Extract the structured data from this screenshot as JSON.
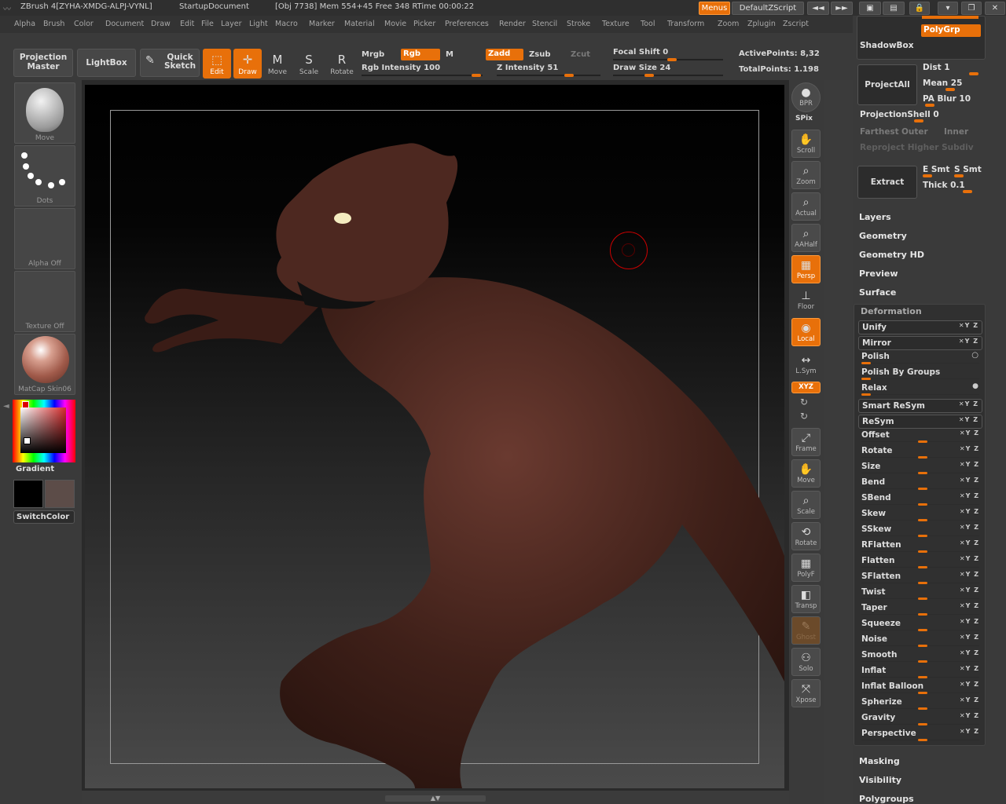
{
  "titlebar": {
    "app_title": "ZBrush 4[ZYHA-XMDG-ALPJ-VYNL]",
    "document": "StartupDocument",
    "status": "[Obj 7738]  Mem 554+45  Free 348  RTime 00:00:22",
    "menus_btn": "Menus",
    "script_btn": "DefaultZScript"
  },
  "menubar": [
    "Alpha",
    "Brush",
    "Color",
    "Document",
    "Draw",
    "Edit",
    "File",
    "Layer",
    "Light",
    "Macro",
    "Marker",
    "Material",
    "Movie",
    "Picker",
    "Preferences",
    "Render",
    "Stencil",
    "Stroke",
    "Texture",
    "Tool",
    "Transform",
    "Zoom",
    "Zplugin",
    "Zscript"
  ],
  "toolbar": {
    "projection_master": "Projection Master",
    "lightbox": "LightBox",
    "quick_sketch": "Quick Sketch",
    "edit": "Edit",
    "draw": "Draw",
    "move": "Move",
    "scale": "Scale",
    "rotate": "Rotate",
    "mrgb": "Mrgb",
    "rgb": "Rgb",
    "m": "M",
    "zadd": "Zadd",
    "zsub": "Zsub",
    "zcut": "Zcut",
    "rgb_intensity": "Rgb Intensity 100",
    "z_intensity": "Z Intensity 51",
    "focal_shift": "Focal Shift 0",
    "draw_size": "Draw Size 24",
    "active_points": "ActivePoints: 8,32",
    "total_points": "TotalPoints: 1.198"
  },
  "left": {
    "brush_label": "Move",
    "stroke_label": "Dots",
    "alpha_label": "Alpha Off",
    "texture_label": "Texture Off",
    "material_label": "MatCap Skin06",
    "gradient": "Gradient",
    "switch_color": "SwitchColor",
    "main_color": "#000000",
    "secondary_color": "#5c4c48"
  },
  "shelf": [
    "BPR",
    "SPix",
    "Scroll",
    "Zoom",
    "Actual",
    "AAHalf",
    "Persp",
    "Floor",
    "Local",
    "L.Sym",
    "XYZ",
    "Frame",
    "Move",
    "Scale",
    "Rotate",
    "PolyF",
    "Transp",
    "Ghost",
    "Solo",
    "Xpose"
  ],
  "right": {
    "polygrp": "PolyGrp",
    "shadowbox": "ShadowBox",
    "projectall": "ProjectAll",
    "dist": "Dist 1",
    "mean": "Mean 25",
    "pa_blur": "PA Blur 10",
    "projection_shell": "ProjectionShell 0",
    "farthest": "Farthest",
    "outer": "Outer",
    "inner": "Inner",
    "reproject": "Reproject Higher Subdiv",
    "extract": "Extract",
    "e_smt": "E Smt",
    "s_smt": "S Smt",
    "thick": "Thick 0.1",
    "sections_top": [
      "Layers",
      "Geometry",
      "Geometry HD",
      "Preview",
      "Surface"
    ],
    "deformation_title": "Deformation",
    "deformation": [
      "Unify",
      "Mirror",
      "Polish",
      "Polish By Groups",
      "Relax",
      "Smart ReSym",
      "ReSym",
      "Offset",
      "Rotate",
      "Size",
      "Bend",
      "SBend",
      "Skew",
      "SSkew",
      "RFlatten",
      "Flatten",
      "SFlatten",
      "Twist",
      "Taper",
      "Squeeze",
      "Noise",
      "Smooth",
      "Inflat",
      "Inflat Balloon",
      "Spherize",
      "Gravity",
      "Perspective"
    ],
    "sections_bottom": [
      "Masking",
      "Visibility",
      "Polygroups"
    ]
  }
}
